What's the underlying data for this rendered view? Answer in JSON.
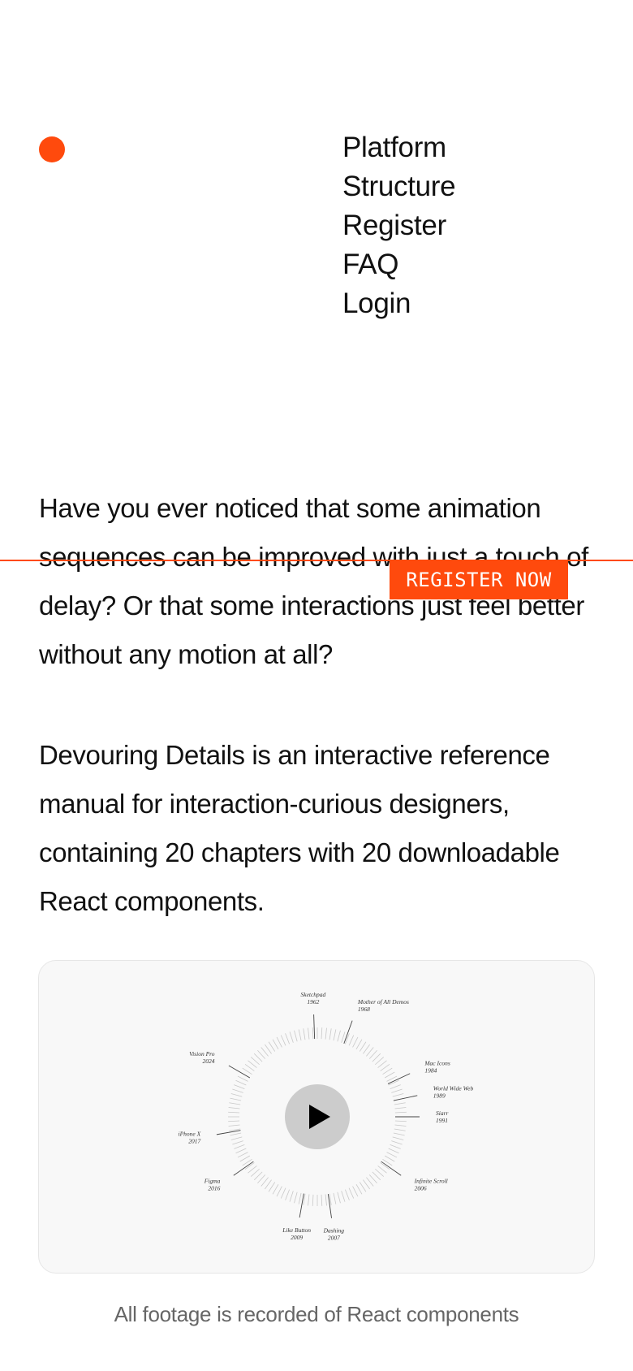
{
  "brand": {
    "accent_color": "#ff4a0d",
    "logo_icon": "orange-circle"
  },
  "nav": {
    "items": [
      {
        "label": "Platform"
      },
      {
        "label": "Structure"
      },
      {
        "label": "Register"
      },
      {
        "label": "FAQ"
      },
      {
        "label": "Login"
      }
    ]
  },
  "intro": {
    "paragraph1": "Have you ever noticed that some animation sequences can be improved with just a touch of delay? Or that some interactions just feel better without any motion at all?",
    "paragraph2": "Devouring Details is an interactive reference manual for interaction-curious designers, containing 20 chapters with 20 downloadable React components."
  },
  "cta": {
    "register_label": "REGISTER NOW"
  },
  "video": {
    "play_icon": "play-icon",
    "timeline_events": [
      {
        "name": "Sketchpad",
        "year": "1962"
      },
      {
        "name": "Mother of All Demos",
        "year": "1968"
      },
      {
        "name": "Mac Icons",
        "year": "1984"
      },
      {
        "name": "World Wide Web",
        "year": "1989"
      },
      {
        "name": "Siarr",
        "year": "1991"
      },
      {
        "name": "Infinite Scroll",
        "year": "2006"
      },
      {
        "name": "Dashing",
        "year": "2007"
      },
      {
        "name": "Like Button",
        "year": "2009"
      },
      {
        "name": "Figma",
        "year": "2016"
      },
      {
        "name": "iPhone X",
        "year": "2017"
      },
      {
        "name": "Vision Pro",
        "year": "2024"
      }
    ]
  },
  "caption": "All footage is recorded of React components"
}
